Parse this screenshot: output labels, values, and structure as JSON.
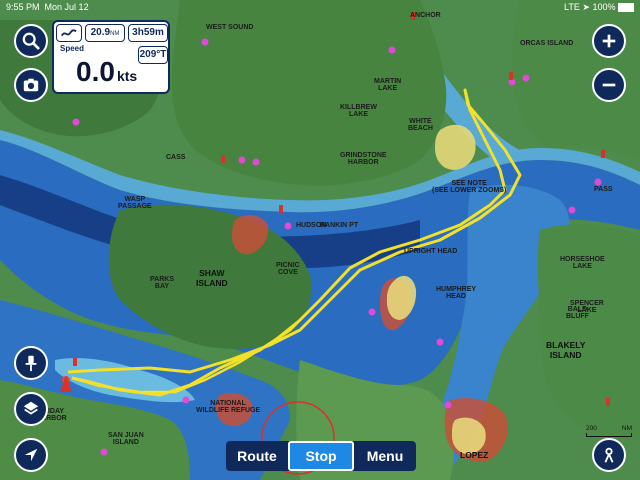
{
  "status_bar": {
    "time": "9:55 PM",
    "date": "Mon Jul 12",
    "network": "LTE",
    "battery": "100%"
  },
  "instruments": {
    "distance_value": "20.9",
    "distance_unit": "NM",
    "eta_value": "3h59m",
    "speed_label": "Speed",
    "speed_value": "0.0",
    "speed_unit": "kts",
    "heading_value": "209°T"
  },
  "bottom_bar": {
    "route_label": "Route",
    "stop_label": "Stop",
    "menu_label": "Menu",
    "active": "Stop"
  },
  "map_labels": {
    "shaw_island": "SHAW\nISLAND",
    "blakely_island": "BLAKELY\nISLAND",
    "lopez": "LOPEZ",
    "killbrew_lake": "KILLBREW\nLAKE",
    "martin_lake": "MARTIN\nLAKE",
    "white_beach": "WHITE\nBEACH",
    "grindstone_harbor": "GRINDSTONE\nHARBOR",
    "wasp_passage": "WASP\nPASSAGE",
    "parks_bay": "PARKS\nBAY",
    "picnic_cove": "PICNIC\nCOVE",
    "rankin_pt": "RANKIN PT",
    "humphrey_head": "HUMPHREY\nHEAD",
    "horseshoe_lake": "HORSESHOE\nLAKE",
    "spencer_lake": "SPENCER\nLAKE",
    "upright_head": "UPRIGHT HEAD",
    "west_sound": "WEST SOUND",
    "orcas_island": "ORCAS ISLAND",
    "anchor": "ANCHOR",
    "see_note": "SEE NOTE\n(SEE LOWER ZOOMS)",
    "friday_harbor": "FRIDAY\nHARBOR",
    "san_juan_island": "SAN JUAN\nISLAND",
    "national_wildlife_refuge": "NATIONAL\nWILDLIFE REFUGE",
    "bald_bluff": "BALD\nBLUFF",
    "hudson": "HUDSON",
    "pass": "PASS",
    "cass": "CASS"
  },
  "scale": {
    "left": "200",
    "right": "NM"
  },
  "colors": {
    "land": "#4c8a4a",
    "water_deep": "#1b4fa0",
    "water_shallow": "#5aaed8",
    "track": "#f2e02a",
    "button": "#0f2a5a",
    "active_tab": "#1e88e5"
  }
}
